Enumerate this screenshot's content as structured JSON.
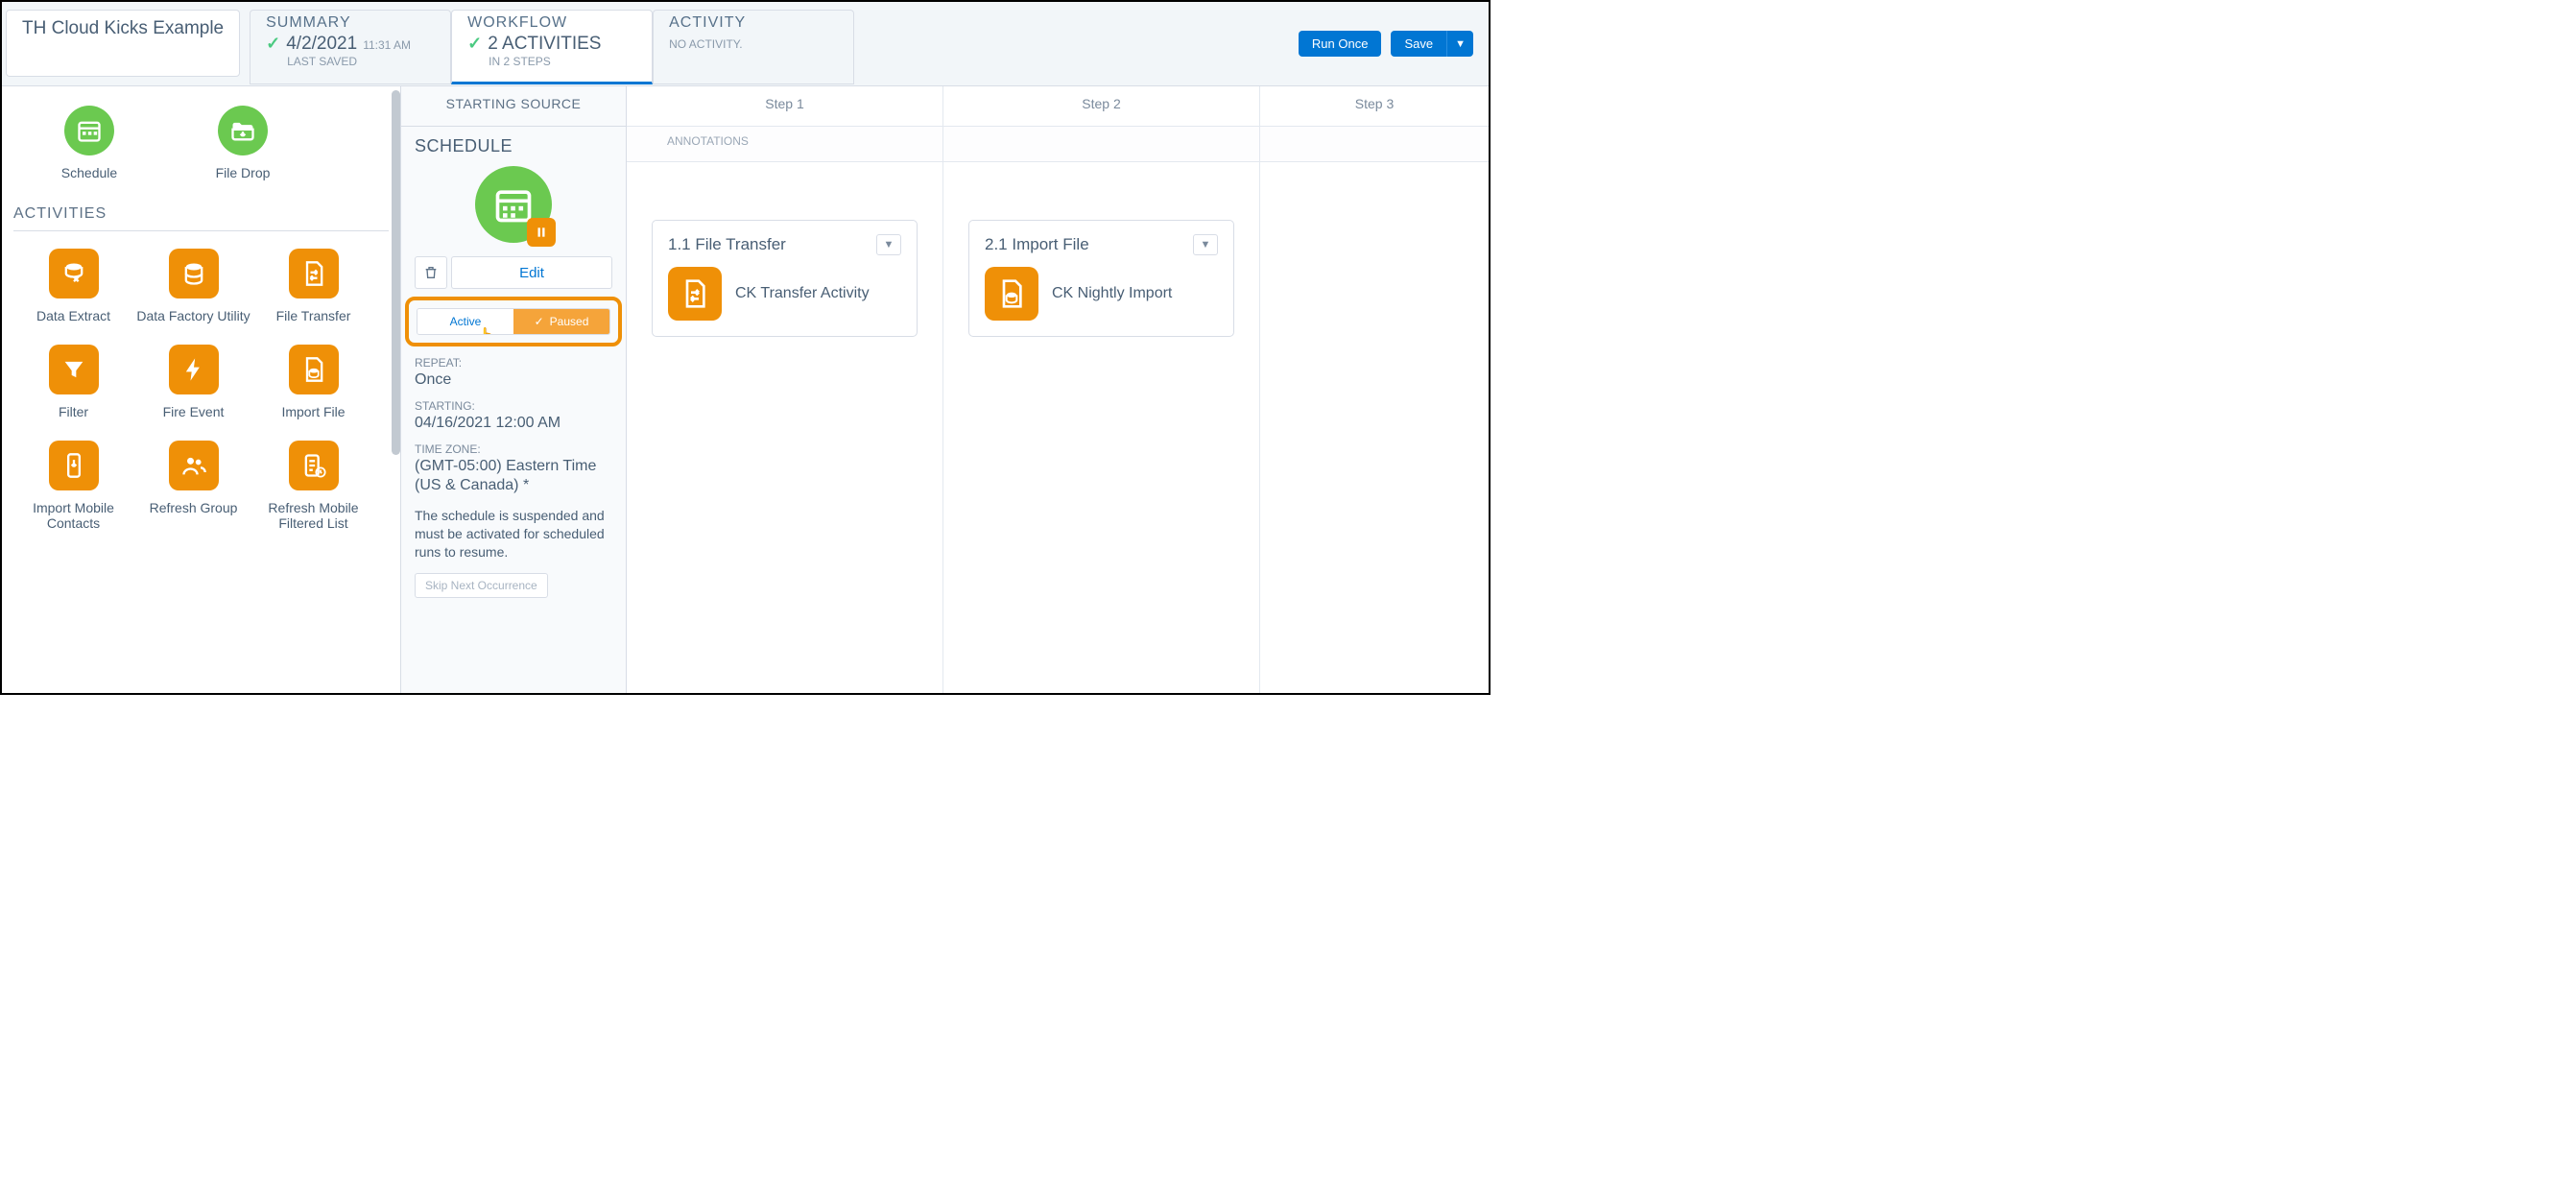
{
  "title": "TH Cloud Kicks Example",
  "tabs": {
    "summary": {
      "label": "SUMMARY",
      "date": "4/2/2021",
      "time": "11:31 AM",
      "sub": "LAST SAVED"
    },
    "workflow": {
      "label": "WORKFLOW",
      "line2": "2 ACTIVITIES",
      "sub": "IN 2 STEPS"
    },
    "activity": {
      "label": "ACTIVITY",
      "line2": "NO ACTIVITY."
    }
  },
  "header_buttons": {
    "run_once": "Run Once",
    "save": "Save"
  },
  "palette": {
    "start": [
      {
        "label": "Schedule",
        "icon": "calendar"
      },
      {
        "label": "File Drop",
        "icon": "file-drop"
      }
    ],
    "heading": "ACTIVITIES",
    "activities": [
      {
        "label": "Data Extract",
        "icon": "data-extract"
      },
      {
        "label": "Data Factory Utility",
        "icon": "data-factory"
      },
      {
        "label": "File Transfer",
        "icon": "file-transfer"
      },
      {
        "label": "Filter",
        "icon": "filter"
      },
      {
        "label": "Fire Event",
        "icon": "fire-event"
      },
      {
        "label": "Import File",
        "icon": "import-file"
      },
      {
        "label": "Import Mobile Contacts",
        "icon": "import-mobile"
      },
      {
        "label": "Refresh Group",
        "icon": "refresh-group"
      },
      {
        "label": "Refresh Mobile Filtered List",
        "icon": "refresh-mobile"
      }
    ]
  },
  "source": {
    "heading": "STARTING SOURCE",
    "title": "SCHEDULE",
    "edit_label": "Edit",
    "toggle": {
      "active": "Active",
      "paused": "Paused"
    },
    "repeat_label": "REPEAT:",
    "repeat_value": "Once",
    "starting_label": "STARTING:",
    "starting_value": "04/16/2021 12:00 AM",
    "tz_label": "TIME ZONE:",
    "tz_value": "(GMT-05:00) Eastern Time (US & Canada) *",
    "note": "The schedule is suspended and must be activated for scheduled runs to resume.",
    "skip_label": "Skip Next Occurrence"
  },
  "steps": {
    "annotations_label": "ANNOTATIONS",
    "cols": [
      {
        "header": "Step 1",
        "card": {
          "title": "1.1 File Transfer",
          "name": "CK Transfer Activity",
          "icon": "file-transfer"
        }
      },
      {
        "header": "Step 2",
        "card": {
          "title": "2.1 Import File",
          "name": "CK Nightly Import",
          "icon": "import-file"
        }
      },
      {
        "header": "Step 3"
      }
    ]
  }
}
